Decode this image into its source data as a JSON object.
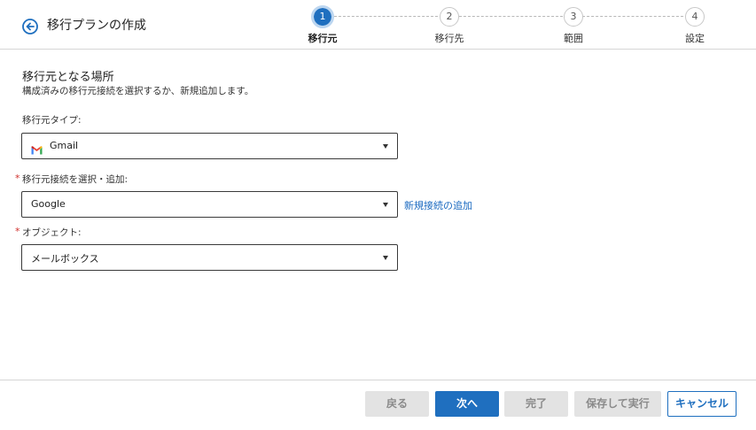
{
  "header": {
    "title": "移行プランの作成"
  },
  "steps": [
    {
      "number": "1",
      "label": "移行元",
      "active": true
    },
    {
      "number": "2",
      "label": "移行先",
      "active": false
    },
    {
      "number": "3",
      "label": "範囲",
      "active": false
    },
    {
      "number": "4",
      "label": "設定",
      "active": false
    }
  ],
  "section": {
    "title": "移行元となる場所",
    "description": "構成済みの移行元接続を選択するか、新規追加します。"
  },
  "fields": {
    "source_type": {
      "label": "移行元タイプ:",
      "value": "Gmail",
      "icon": "gmail-icon"
    },
    "connection": {
      "label": "移行元接続を選択・追加:",
      "value": "Google",
      "required_mark": "*",
      "add_link": "新規接続の追加"
    },
    "object": {
      "label": "オブジェクト:",
      "value": "メールボックス",
      "required_mark": "*"
    }
  },
  "footer": {
    "back": "戻る",
    "next": "次へ",
    "finish": "完了",
    "save_run": "保存して実行",
    "cancel": "キャンセル"
  },
  "colors": {
    "accent": "#1f6fbf",
    "required": "#d0312d",
    "link": "#1b6ac0"
  }
}
